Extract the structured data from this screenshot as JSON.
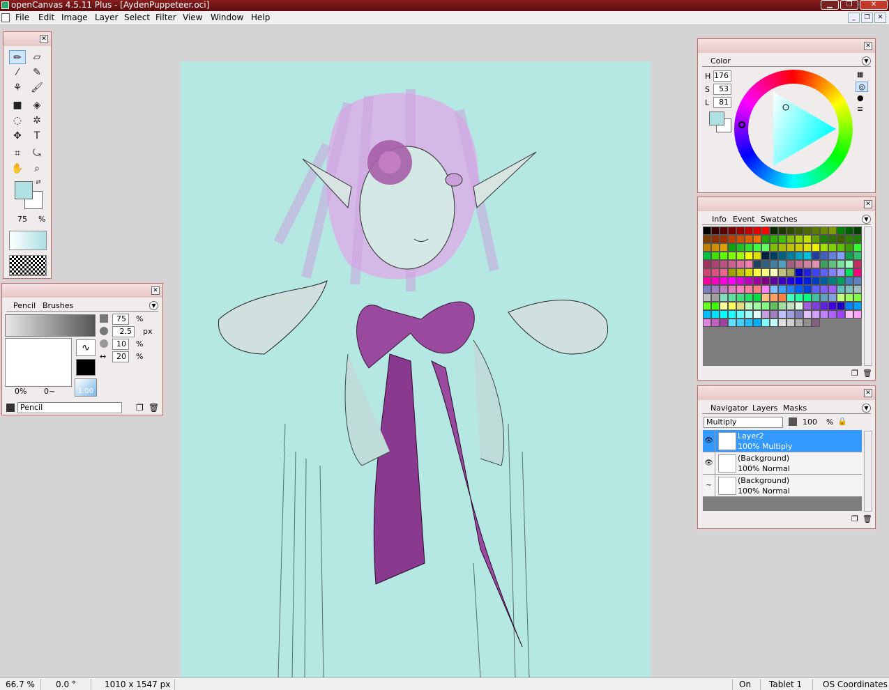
{
  "app": {
    "title": "openCanvas 4.5.11 Plus - [AydenPuppeteer.oci]"
  },
  "menu": [
    "File",
    "Edit",
    "Image",
    "Layer",
    "Select",
    "Filter",
    "View",
    "Window",
    "Help"
  ],
  "window_buttons": {
    "min": "▁",
    "max": "❐",
    "close": "✕"
  },
  "mdi_buttons": {
    "min": "_",
    "restore": "❐",
    "close": "✕"
  },
  "toolbox": {
    "zoom_value": "75",
    "zoom_unit": "%",
    "fg_color": "#aee0e4",
    "bg_color": "#ffffff"
  },
  "brush_panel": {
    "tabs": [
      "Pencil",
      "Brushes"
    ],
    "opacity": "75",
    "opacity_unit": "%",
    "size": "2.5",
    "size_unit": "px",
    "min_size": "10",
    "min_size_unit": "%",
    "density": "20",
    "density_unit": "%",
    "angle_left": "0%",
    "angle_right": "0~",
    "scale": "1.00",
    "name": "Pencil"
  },
  "color_panel": {
    "tab": "Color",
    "h_label": "H",
    "h": "176",
    "s_label": "S",
    "s": "53",
    "l_label": "L",
    "l": "81",
    "swatch": "#aee0e4"
  },
  "info_panel": {
    "tabs": [
      "Info",
      "Event",
      "Swatches"
    ]
  },
  "swatches": [
    "#000000",
    "#3a0000",
    "#5a0000",
    "#7a0000",
    "#9a0000",
    "#c00000",
    "#e00000",
    "#ff0000",
    "#0a2a00",
    "#1a3a00",
    "#2a4a00",
    "#3a5a00",
    "#4a6a00",
    "#5a7a00",
    "#6a8a00",
    "#7a9a00",
    "#008000",
    "#006000",
    "#004000",
    "#804000",
    "#903000",
    "#a03000",
    "#c04000",
    "#d05000",
    "#e06000",
    "#f07000",
    "#20a000",
    "#30b000",
    "#40c000",
    "#80c000",
    "#a0d000",
    "#c0e000",
    "#60a000",
    "#208000",
    "#307000",
    "#406000",
    "#308000",
    "#208000",
    "#c08000",
    "#d09000",
    "#e0a000",
    "#10a010",
    "#20c020",
    "#30e030",
    "#40ff40",
    "#60ff60",
    "#80c000",
    "#a0c000",
    "#c0c000",
    "#d0d000",
    "#e0e000",
    "#f0f000",
    "#a0e000",
    "#80d000",
    "#60c000",
    "#40a000",
    "#30ff30",
    "#00c040",
    "#40e000",
    "#60ff00",
    "#80ff00",
    "#a0ff00",
    "#ffff00",
    "#e0e000",
    "#002040",
    "#004060",
    "#006080",
    "#0080a0",
    "#00a0c0",
    "#00c0e0",
    "#2040a0",
    "#4060c0",
    "#6080e0",
    "#80a0ff",
    "#10a050",
    "#30c070",
    "#a03060",
    "#b04070",
    "#c05080",
    "#d06090",
    "#e070a0",
    "#f080b0",
    "#204060",
    "#306080",
    "#4080a0",
    "#50a0c0",
    "#a06080",
    "#c07090",
    "#d080a0",
    "#e090b0",
    "#40a060",
    "#60c080",
    "#80e0a0",
    "#a0ffc0",
    "#c03060",
    "#d04070",
    "#e05080",
    "#f06090",
    "#a0a000",
    "#c0c000",
    "#e0e000",
    "#ffff40",
    "#ffff80",
    "#ffffc0",
    "#c0c080",
    "#a0a060",
    "#0000c0",
    "#2020e0",
    "#4040ff",
    "#6060ff",
    "#8080ff",
    "#a0a0ff",
    "#00e060",
    "#ff0080",
    "#ff00a0",
    "#ff00c0",
    "#ff00e0",
    "#ff00ff",
    "#e000e0",
    "#c000c0",
    "#a000a0",
    "#800080",
    "#6000a0",
    "#4000c0",
    "#2000e0",
    "#0000ff",
    "#0020e0",
    "#0040c0",
    "#0060a0",
    "#008080",
    "#00a060",
    "#4080c0",
    "#6080c0",
    "#8080c0",
    "#a080c0",
    "#c080c0",
    "#e080c0",
    "#ff80c0",
    "#ff80a0",
    "#ff8080",
    "#ff80ff",
    "#80c0ff",
    "#40a0ff",
    "#2080ff",
    "#0060ff",
    "#0040e0",
    "#6060ff",
    "#8060ff",
    "#a060ff",
    "#60c0c0",
    "#80c0c0",
    "#a0c0c0",
    "#c0c0c0",
    "#a0a0a0",
    "#80e0c0",
    "#60e0a0",
    "#40e080",
    "#20e060",
    "#00e040",
    "#ffc080",
    "#ffa060",
    "#ff8040",
    "#40ffc0",
    "#20ffa0",
    "#00ff80",
    "#40c0a0",
    "#60a0c0",
    "#80a0e0",
    "#c0ff80",
    "#a0ff60",
    "#80ff40",
    "#60ff20",
    "#40ff00",
    "#ffffa0",
    "#ffff60",
    "#e0e080",
    "#c0ffc0",
    "#a0ffa0",
    "#80ff80",
    "#60c060",
    "#a0e0a0",
    "#c0e0c0",
    "#e0ffe0",
    "#a060e0",
    "#8040e0",
    "#6020e0",
    "#4000e0",
    "#2000c0",
    "#0080ff",
    "#00a0ff",
    "#00c0ff",
    "#00e0ff",
    "#00ffff",
    "#20ffff",
    "#60ffff",
    "#a0ffff",
    "#e0ffff",
    "#c0a0e0",
    "#a080c0",
    "#c0c0ff",
    "#a0a0e0",
    "#8080c0",
    "#e0c0ff",
    "#d0a0ff",
    "#c080ff",
    "#b060ff",
    "#a040ff",
    "#ffc0ff",
    "#ffa0ff",
    "#e080e0",
    "#c060c0",
    "#a040a0",
    "#60e0ff",
    "#40d0ff",
    "#20c0ff",
    "#00b0ff",
    "#80ffff",
    "#c0ffff",
    "#e0e0e0",
    "#d0d0d0",
    "#b0b0b0",
    "#909090",
    "#806080"
  ],
  "layers_panel": {
    "tabs": [
      "Navigator",
      "Layers",
      "Masks"
    ],
    "blend_mode": "Multiply",
    "opacity": "100",
    "opacity_unit": "%",
    "layers": [
      {
        "name": "Layer2",
        "info": "100% Multiply",
        "selected": true,
        "eye": "👁"
      },
      {
        "name": "(Background)",
        "info": "100% Normal",
        "selected": false,
        "eye": "👁"
      },
      {
        "name": "(Background)",
        "info": "100% Normal",
        "selected": false,
        "eye": "~"
      }
    ]
  },
  "status": {
    "zoom": "66.7 %",
    "angle": "0.0 °",
    "dimensions": "1010 x 1547 px",
    "tablet_state": "On",
    "tablet": "Tablet 1",
    "coords": "OS Coordinates"
  }
}
